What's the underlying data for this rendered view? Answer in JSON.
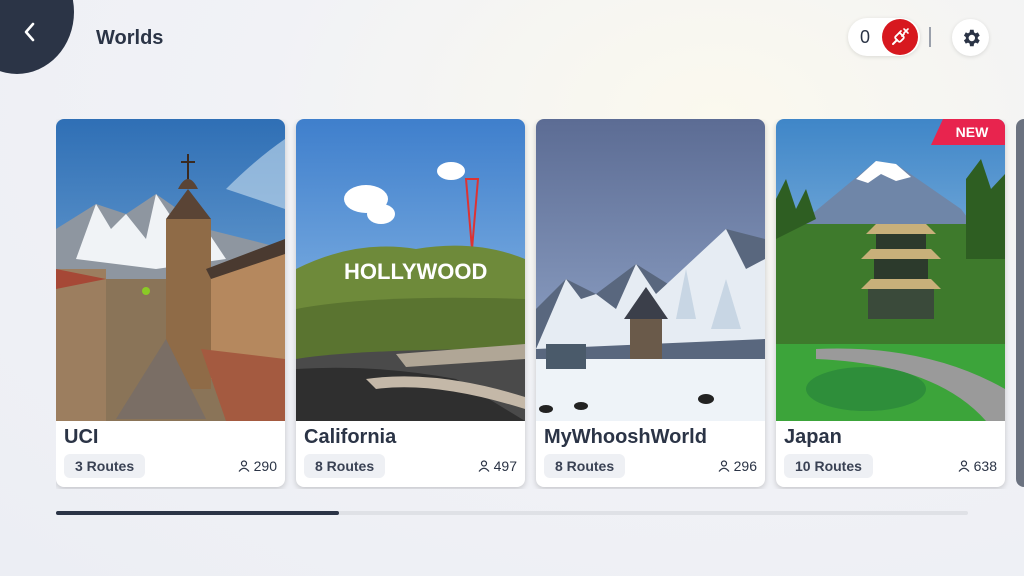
{
  "header": {
    "title": "Worlds",
    "counter_value": "0",
    "back_icon": "chevron-left-icon",
    "unplug_icon": "unplug-icon",
    "settings_icon": "gear-icon"
  },
  "worlds": [
    {
      "name": "UCI",
      "routes": "3 Routes",
      "riders": "290",
      "badge": ""
    },
    {
      "name": "California",
      "routes": "8 Routes",
      "riders": "497",
      "badge": "",
      "sign": "HOLLYWOOD"
    },
    {
      "name": "MyWhooshWorld",
      "routes": "8 Routes",
      "riders": "296",
      "badge": ""
    },
    {
      "name": "Japan",
      "routes": "10 Routes",
      "riders": "638",
      "badge": "NEW"
    }
  ],
  "scroll": {
    "position_fraction": 0.31
  },
  "colors": {
    "dark": "#2b3446",
    "accent_red": "#d7181f",
    "new_badge": "#e8244e"
  }
}
